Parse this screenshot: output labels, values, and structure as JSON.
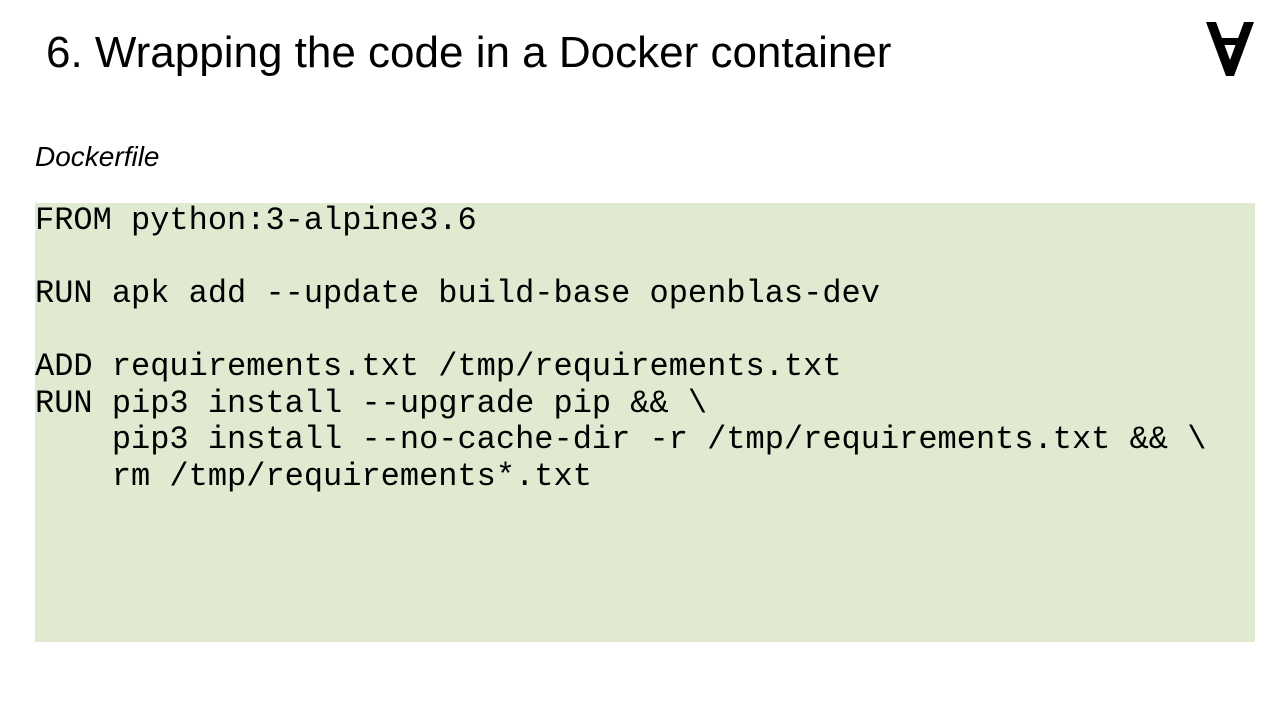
{
  "slide": {
    "title": "6. Wrapping the code in a Docker container",
    "logo_icon": "inverted-a-logo",
    "subtitle": "Dockerfile"
  },
  "code": {
    "background_color": "#dfead0",
    "lines": [
      "FROM python:3-alpine3.6",
      "",
      "RUN apk add --update build-base openblas-dev",
      "",
      "ADD requirements.txt /tmp/requirements.txt",
      "RUN pip3 install --upgrade pip && \\",
      "    pip3 install --no-cache-dir -r /tmp/requirements.txt && \\",
      "    rm /tmp/requirements*.txt"
    ]
  }
}
